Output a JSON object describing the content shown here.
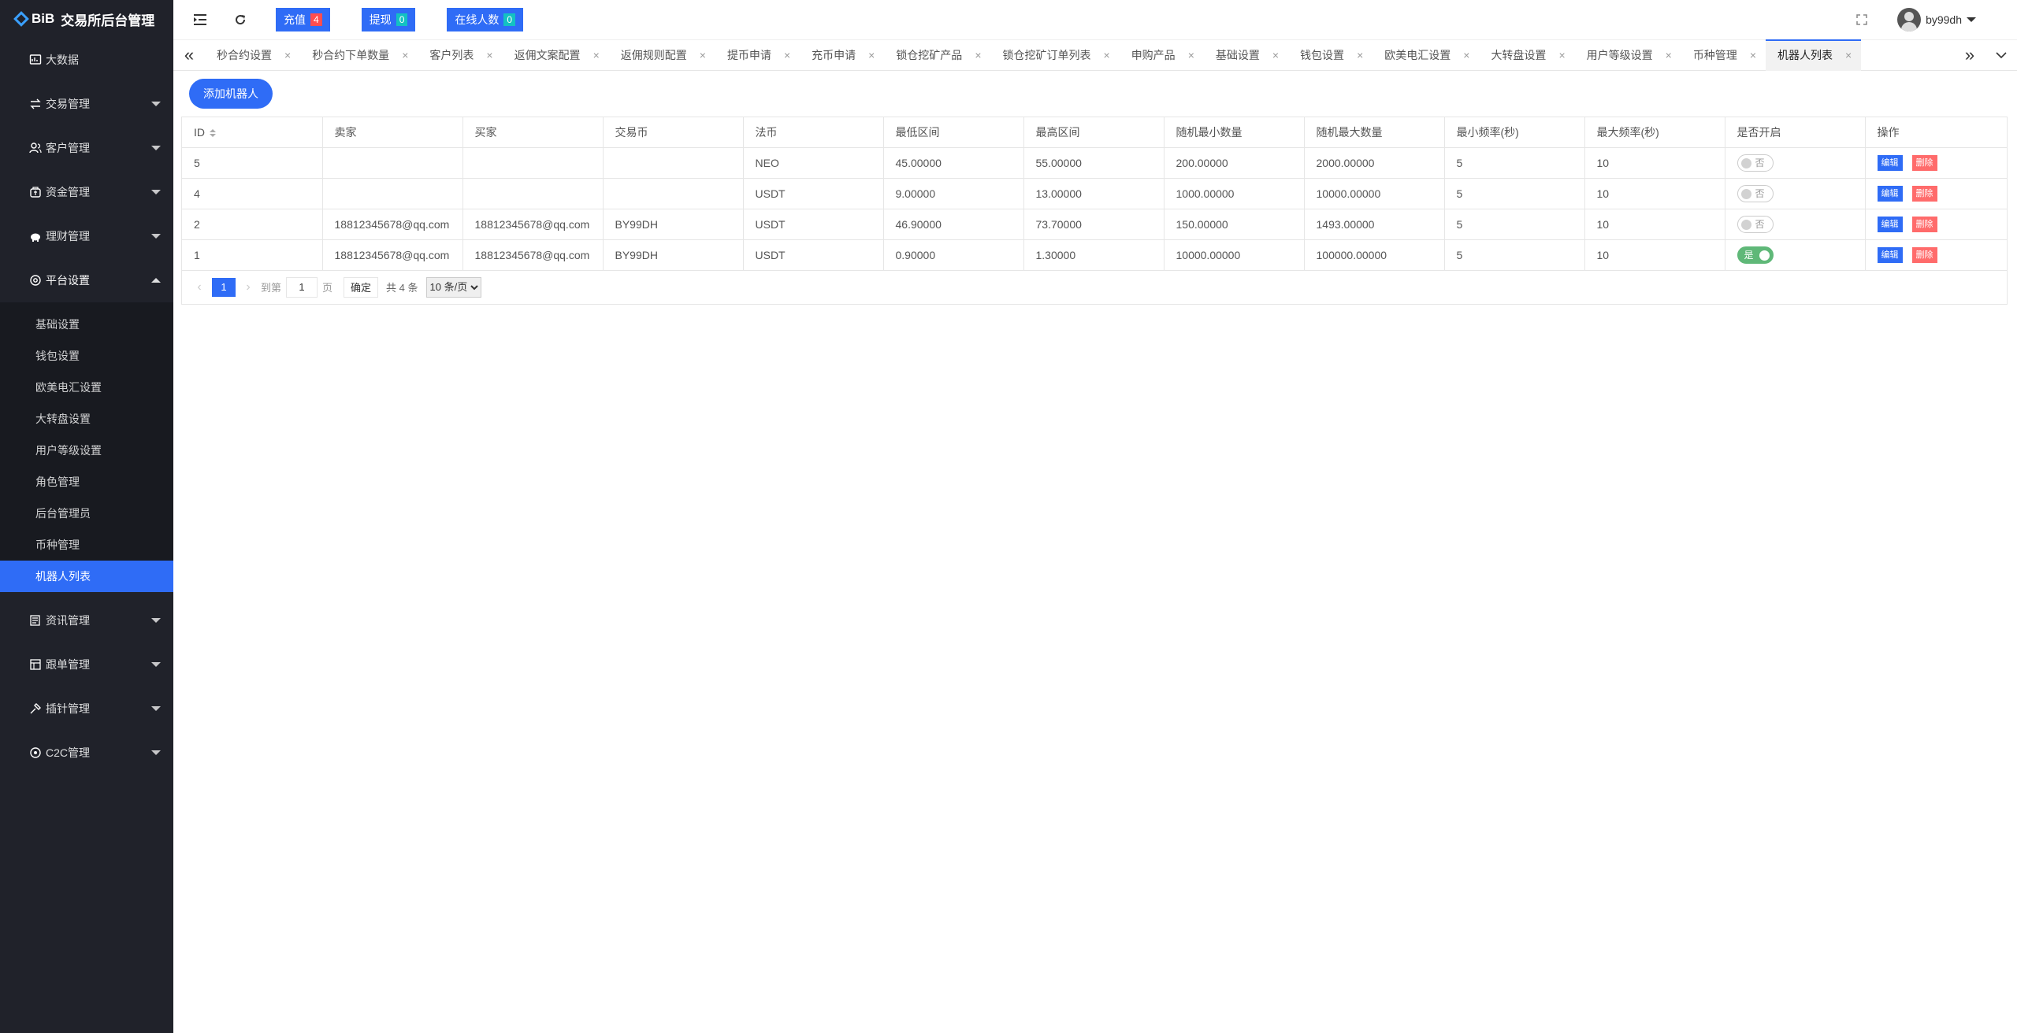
{
  "app": {
    "logo_text": "BiB",
    "title": "交易所后台管理"
  },
  "colors": {
    "primary": "#2f6cf6",
    "sidebar_bg": "#20222a",
    "danger": "#ff6b6b",
    "switch_on": "#5fb878"
  },
  "sidebar": {
    "items": [
      {
        "label": "大数据",
        "icon": "dashboard-icon",
        "has_caret": false
      },
      {
        "label": "交易管理",
        "icon": "exchange-icon",
        "has_caret": true
      },
      {
        "label": "客户管理",
        "icon": "users-icon",
        "has_caret": true
      },
      {
        "label": "资金管理",
        "icon": "wallet-icon",
        "has_caret": true
      },
      {
        "label": "理财管理",
        "icon": "piggy-bank-icon",
        "has_caret": true
      },
      {
        "label": "平台设置",
        "icon": "settings-icon",
        "has_caret": true,
        "open": true
      }
    ],
    "sub_items": [
      {
        "label": "基础设置"
      },
      {
        "label": "钱包设置"
      },
      {
        "label": "欧美电汇设置"
      },
      {
        "label": "大转盘设置"
      },
      {
        "label": "用户等级设置"
      },
      {
        "label": "角色管理"
      },
      {
        "label": "后台管理员"
      },
      {
        "label": "币种管理"
      },
      {
        "label": "机器人列表",
        "active": true
      }
    ],
    "items_after": [
      {
        "label": "资讯管理",
        "icon": "news-icon"
      },
      {
        "label": "跟单管理",
        "icon": "copy-trade-icon"
      },
      {
        "label": "插针管理",
        "icon": "pin-icon"
      },
      {
        "label": "C2C管理",
        "icon": "c2c-icon"
      }
    ]
  },
  "header": {
    "recharge": {
      "label": "充值",
      "count": "4"
    },
    "withdraw": {
      "label": "提现",
      "count": "0"
    },
    "online": {
      "label": "在线人数",
      "count": "0"
    },
    "username": "by99dh"
  },
  "tabs": [
    {
      "label": "秒合约设置"
    },
    {
      "label": "秒合约下单数量"
    },
    {
      "label": "客户列表"
    },
    {
      "label": "返佣文案配置"
    },
    {
      "label": "返佣规则配置"
    },
    {
      "label": "提币申请"
    },
    {
      "label": "充币申请"
    },
    {
      "label": "锁仓挖矿产品"
    },
    {
      "label": "锁仓挖矿订单列表"
    },
    {
      "label": "申购产品"
    },
    {
      "label": "基础设置"
    },
    {
      "label": "钱包设置"
    },
    {
      "label": "欧美电汇设置"
    },
    {
      "label": "大转盘设置"
    },
    {
      "label": "用户等级设置"
    },
    {
      "label": "币种管理"
    },
    {
      "label": "机器人列表",
      "active": true
    }
  ],
  "main": {
    "add_button": "添加机器人",
    "columns": [
      "ID",
      "卖家",
      "买家",
      "交易币",
      "法币",
      "最低区间",
      "最高区间",
      "随机最小数量",
      "随机最大数量",
      "最小频率(秒)",
      "最大频率(秒)",
      "是否开启",
      "操作"
    ],
    "rows": [
      {
        "id": "5",
        "seller": "",
        "buyer": "",
        "coin": "",
        "fiat": "NEO",
        "min_range": "45.00000",
        "max_range": "55.00000",
        "rand_min": "200.00000",
        "rand_max": "2000.00000",
        "min_freq": "5",
        "max_freq": "10",
        "enabled": false,
        "switch_label": "否",
        "edit_label": "编辑",
        "delete_label": "删除"
      },
      {
        "id": "4",
        "seller": "",
        "buyer": "",
        "coin": "",
        "fiat": "USDT",
        "min_range": "9.00000",
        "max_range": "13.00000",
        "rand_min": "1000.00000",
        "rand_max": "10000.00000",
        "min_freq": "5",
        "max_freq": "10",
        "enabled": false,
        "switch_label": "否",
        "edit_label": "编辑",
        "delete_label": "删除"
      },
      {
        "id": "2",
        "seller": "18812345678@qq.com",
        "buyer": "18812345678@qq.com",
        "coin": "BY99DH",
        "fiat": "USDT",
        "min_range": "46.90000",
        "max_range": "73.70000",
        "rand_min": "150.00000",
        "rand_max": "1493.00000",
        "min_freq": "5",
        "max_freq": "10",
        "enabled": false,
        "switch_label": "否",
        "edit_label": "编辑",
        "delete_label": "删除"
      },
      {
        "id": "1",
        "seller": "18812345678@qq.com",
        "buyer": "18812345678@qq.com",
        "coin": "BY99DH",
        "fiat": "USDT",
        "min_range": "0.90000",
        "max_range": "1.30000",
        "rand_min": "10000.00000",
        "rand_max": "100000.00000",
        "min_freq": "5",
        "max_freq": "10",
        "enabled": true,
        "switch_label": "是",
        "edit_label": "编辑",
        "delete_label": "删除"
      }
    ],
    "pager": {
      "current_page": "1",
      "goto_label": "到第",
      "goto_value": "1",
      "page_unit": "页",
      "confirm_label": "确定",
      "total_text": "共 4 条",
      "page_size": "10 条/页"
    }
  }
}
